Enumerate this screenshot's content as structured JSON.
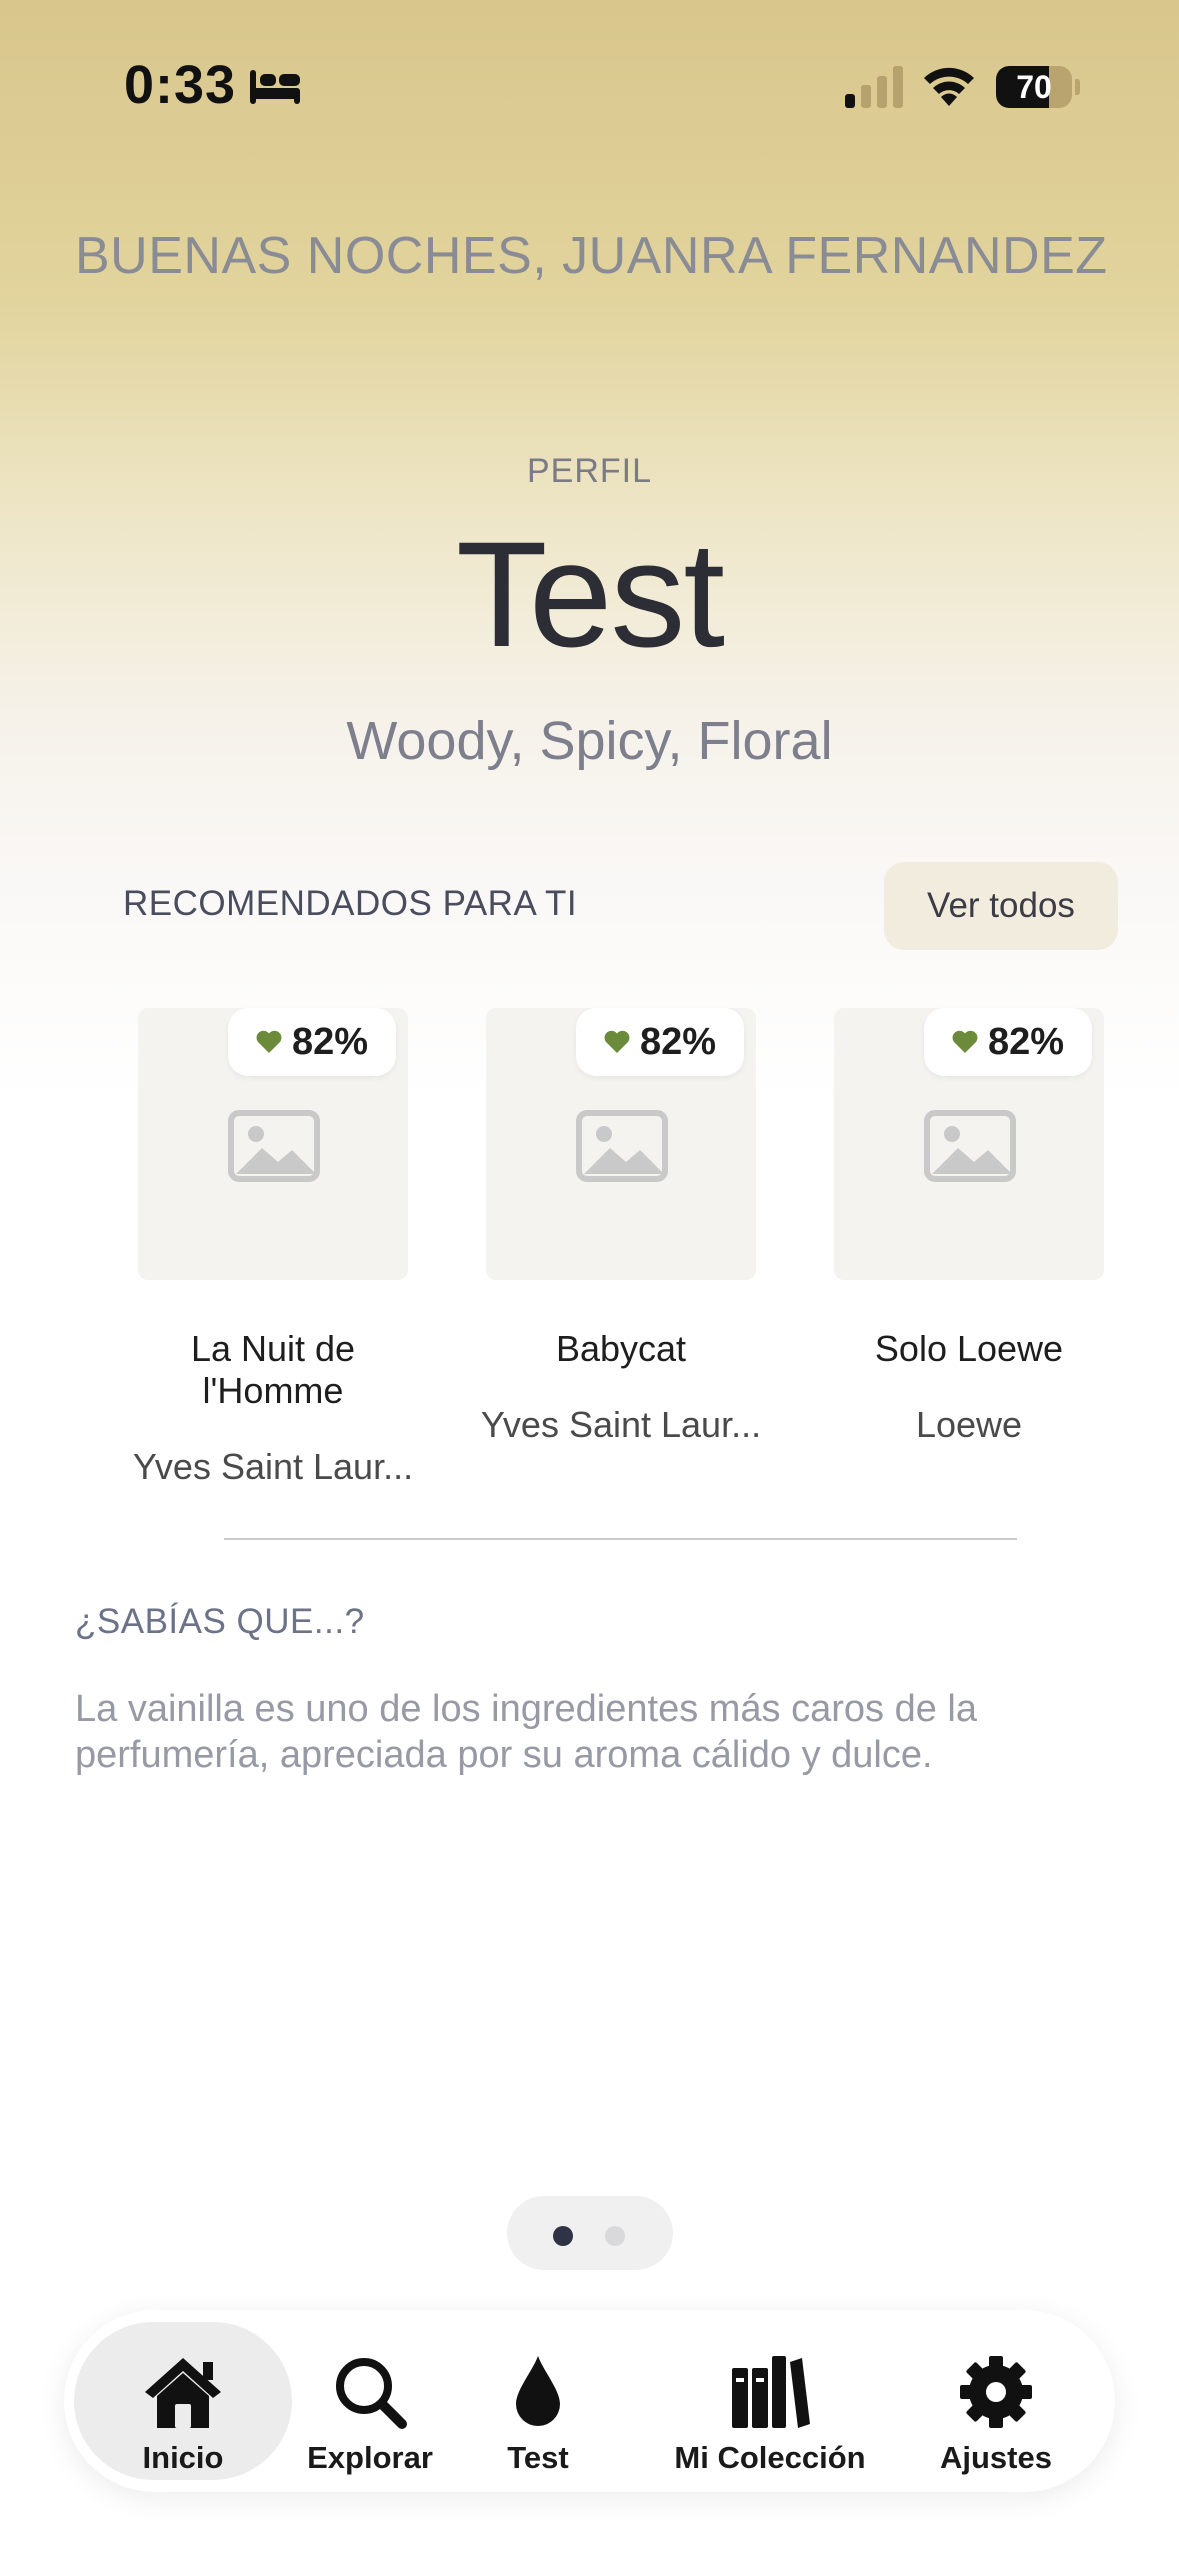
{
  "status_bar": {
    "time": "0:33",
    "battery_level": "70",
    "battery_fraction": 0.7
  },
  "greeting": "BUENAS NOCHES, JUANRA FERNANDEZ",
  "profile": {
    "label": "PERFIL",
    "name": "Test",
    "notes": "Woody, Spicy, Floral"
  },
  "recommended": {
    "title": "RECOMENDADOS PARA TI",
    "see_all_label": "Ver todos",
    "items": [
      {
        "match": "82%",
        "name": "La Nuit de l'Homme",
        "brand": "Yves Saint Laur..."
      },
      {
        "match": "82%",
        "name": "Babycat",
        "brand": "Yves Saint Laur..."
      },
      {
        "match": "82%",
        "name": "Solo Loewe",
        "brand": "Loewe"
      }
    ]
  },
  "fact": {
    "title": "¿SABÍAS QUE...?",
    "text": "La vainilla es uno de los ingredientes más caros de la perfumería, apreciada por su aroma cálido y dulce."
  },
  "pager": {
    "count": 2,
    "active_index": 0
  },
  "tabs": [
    {
      "label": "Inicio",
      "icon": "home-icon",
      "active": true
    },
    {
      "label": "Explorar",
      "icon": "search-icon",
      "active": false
    },
    {
      "label": "Test",
      "icon": "drop-icon",
      "active": false
    },
    {
      "label": "Mi Colección",
      "icon": "books-icon",
      "active": false
    },
    {
      "label": "Ajustes",
      "icon": "gear-icon",
      "active": false
    }
  ],
  "colors": {
    "accent_heart": "#6b8a3a",
    "header_gold": "#d8c68c",
    "see_all_bg": "#f2ecdf"
  }
}
